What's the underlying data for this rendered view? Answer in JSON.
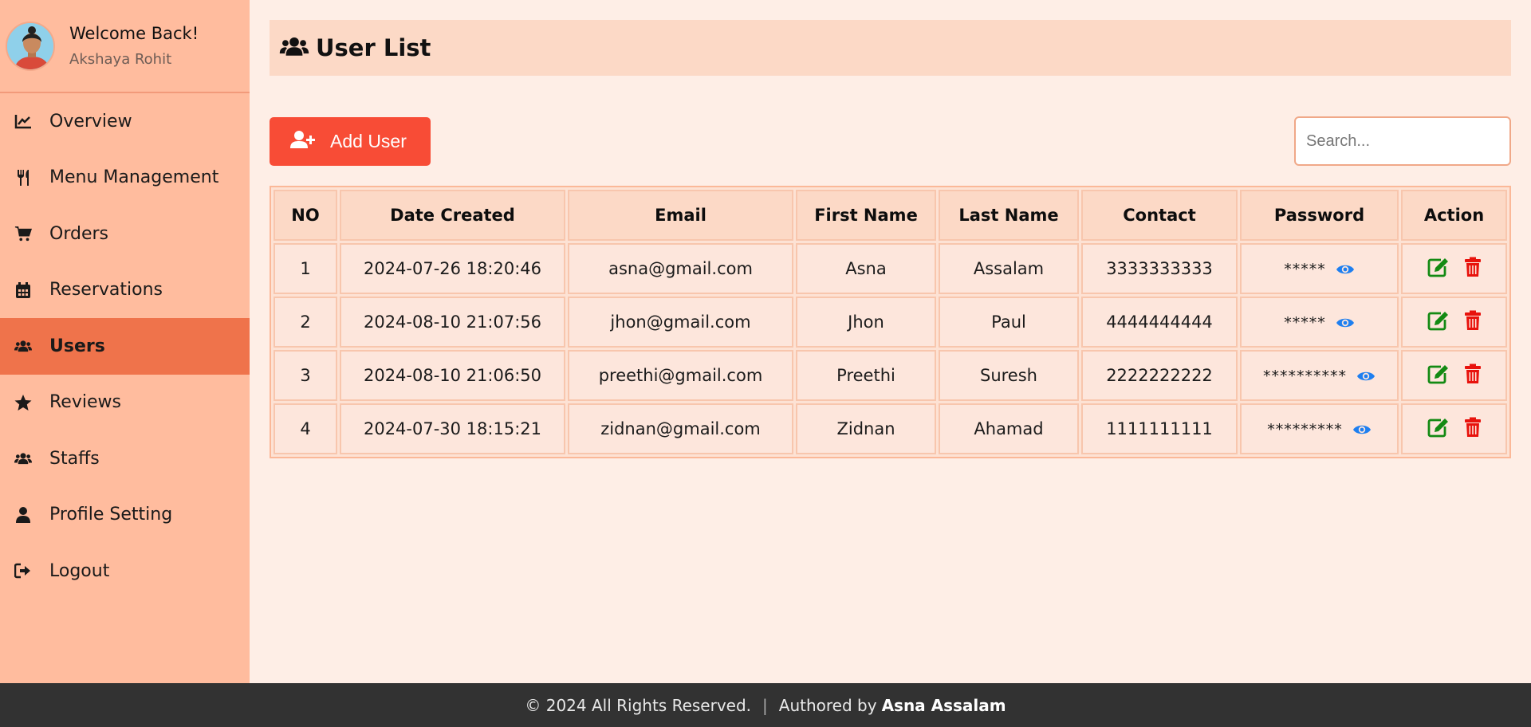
{
  "profile": {
    "welcome": "Welcome Back!",
    "name": "Akshaya Rohit"
  },
  "nav": [
    {
      "label": "Overview",
      "icon": "chart-line-icon"
    },
    {
      "label": "Menu Management",
      "icon": "utensils-icon"
    },
    {
      "label": "Orders",
      "icon": "cart-icon"
    },
    {
      "label": "Reservations",
      "icon": "calendar-icon"
    },
    {
      "label": "Users",
      "icon": "users-icon",
      "active": true
    },
    {
      "label": "Reviews",
      "icon": "star-icon"
    },
    {
      "label": "Staffs",
      "icon": "users-icon"
    },
    {
      "label": "Profile Setting",
      "icon": "user-icon"
    },
    {
      "label": "Logout",
      "icon": "logout-icon"
    }
  ],
  "page": {
    "title": "User List"
  },
  "toolbar": {
    "add_label": "Add User",
    "search_placeholder": "Search..."
  },
  "table": {
    "headers": [
      "NO",
      "Date Created",
      "Email",
      "First Name",
      "Last Name",
      "Contact",
      "Password",
      "Action"
    ],
    "rows": [
      {
        "no": "1",
        "date": "2024-07-26 18:20:46",
        "email": "asna@gmail.com",
        "first": "Asna",
        "last": "Assalam",
        "contact": "3333333333",
        "password": "*****"
      },
      {
        "no": "2",
        "date": "2024-08-10 21:07:56",
        "email": "jhon@gmail.com",
        "first": "Jhon",
        "last": "Paul",
        "contact": "4444444444",
        "password": "*****"
      },
      {
        "no": "3",
        "date": "2024-08-10 21:06:50",
        "email": "preethi@gmail.com",
        "first": "Preethi",
        "last": "Suresh",
        "contact": "2222222222",
        "password": "**********"
      },
      {
        "no": "4",
        "date": "2024-07-30 18:15:21",
        "email": "zidnan@gmail.com",
        "first": "Zidnan",
        "last": "Ahamad",
        "contact": "1111111111",
        "password": "*********"
      }
    ]
  },
  "footer": {
    "copyright": "© 2024 All Rights Reserved.",
    "separator": "|",
    "authored_prefix": "Authored by",
    "author": "Asna Assalam"
  },
  "colors": {
    "sidebar": "#ffbc9e",
    "active": "#ef734b",
    "accent": "#f84c36",
    "edit": "#138a13",
    "delete": "#e8120c",
    "eye": "#1e7ff0"
  }
}
